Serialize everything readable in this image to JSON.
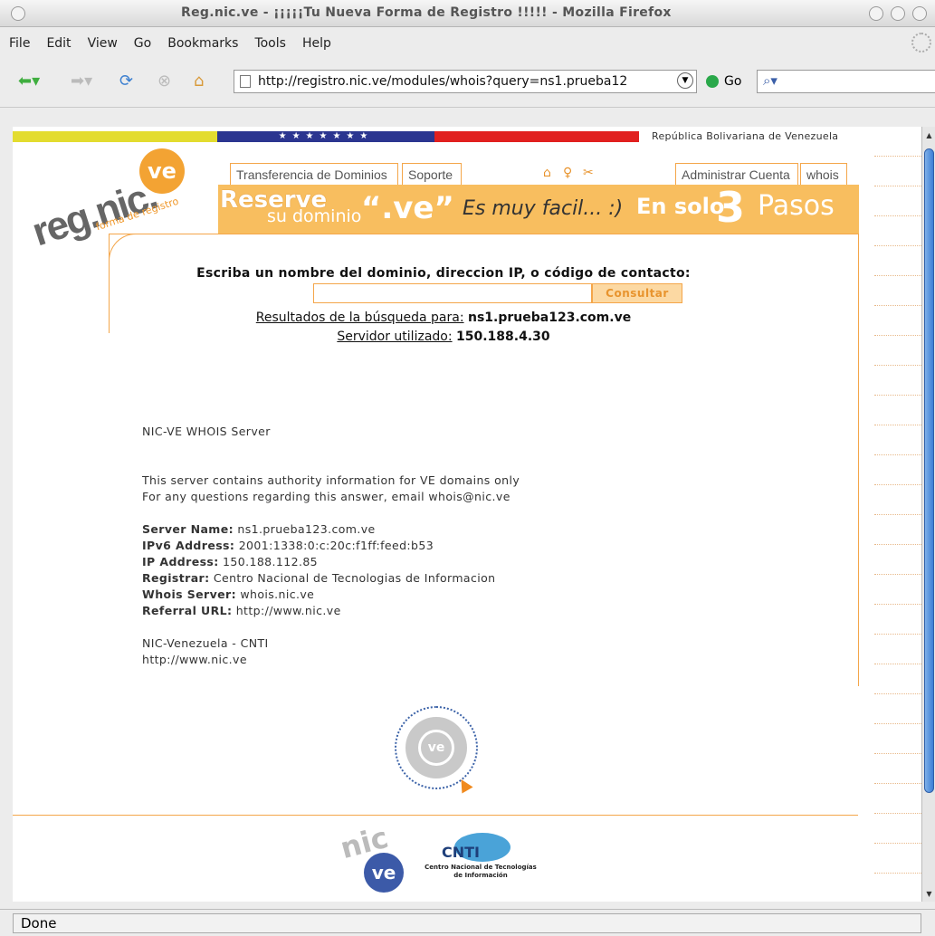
{
  "window": {
    "title": "Reg.nic.ve - ¡¡¡¡¡Tu Nueva Forma de Registro !!!!! - Mozilla Firefox"
  },
  "menu": [
    "File",
    "Edit",
    "View",
    "Go",
    "Bookmarks",
    "Tools",
    "Help"
  ],
  "nav": {
    "url": "http://registro.nic.ve/modules/whois?query=ns1.prueba12",
    "go_label": "Go"
  },
  "header": {
    "republic": "República Bolivariana de Venezuela",
    "logo_text": "reg.nic.",
    "logo_circle": "ve",
    "logo_sub": "forma de registro",
    "tabs_left": [
      "Transferencia de Dominios",
      "Soporte"
    ],
    "tabs_right": [
      "Administrar Cuenta",
      "whois"
    ],
    "icons": [
      "home-icon",
      "info-icon",
      "tools-icon"
    ]
  },
  "banner": {
    "reserve": "Reserve",
    "su_dominio": "su dominio",
    "ve": "“.ve”",
    "facil": "Es muy facil... :)",
    "en_solo": "En solo",
    "three": "3",
    "pasos": "Pasos"
  },
  "search": {
    "prompt": "Escriba un nombre del dominio, direccion IP, o código de contacto:",
    "input_value": "",
    "button": "Consultar",
    "results_label": "Resultados de la búsqueda para:",
    "results_value": "ns1.prueba123.com.ve",
    "server_label": "Servidor utilizado:",
    "server_value": "150.188.4.30"
  },
  "whois": {
    "header": "NIC-VE WHOIS Server",
    "info1": "This server contains authority information for VE domains only",
    "info2": "For any questions regarding this answer, email whois@nic.ve",
    "fields": [
      {
        "label": "Server Name:",
        "value": "ns1.prueba123.com.ve"
      },
      {
        "label": "IPv6 Address:",
        "value": "2001:1338:0:c:20c:f1ff:feed:b53"
      },
      {
        "label": "IP Address:",
        "value": "150.188.112.85"
      },
      {
        "label": "Registrar:",
        "value": "Centro Nacional de Tecnologias de Informacion"
      },
      {
        "label": "Whois Server:",
        "value": "whois.nic.ve"
      },
      {
        "label": "Referral URL:",
        "value": "http://www.nic.ve"
      }
    ],
    "footer1": "NIC-Venezuela - CNTI",
    "footer2": "http://www.nic.ve"
  },
  "badge": {
    "ring_text": "Agente Registrador Autorizado",
    "center": "ve"
  },
  "footer": {
    "logo1_nic": "nic",
    "logo1_ve": "ve",
    "logo2_cn": "CNTI",
    "logo2_text": "Centro Nacional de Tecnologías de Información"
  },
  "status": "Done",
  "colors": {
    "accent": "#f4a64a",
    "banner": "#f8be5f",
    "flag_yellow": "#e3dc2f",
    "flag_blue": "#2b3590",
    "flag_red": "#e1201f"
  }
}
